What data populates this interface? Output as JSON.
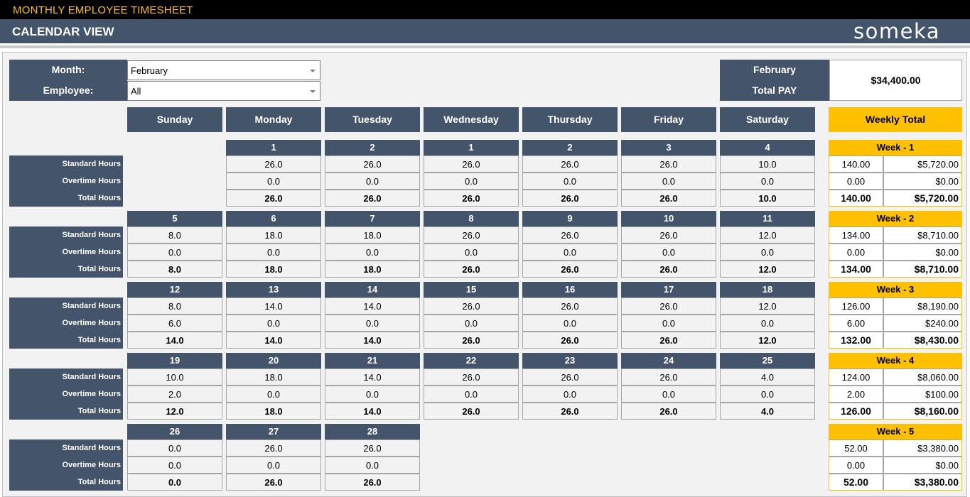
{
  "header": {
    "title": "MONTHLY EMPLOYEE TIMESHEET",
    "subtitle": "CALENDAR VIEW",
    "logo": "someka"
  },
  "filters": {
    "month_label": "Month:",
    "month_value": "February",
    "employee_label": "Employee:",
    "employee_value": "All"
  },
  "summary": {
    "month": "February",
    "label": "Total PAY",
    "value": "$34,400.00"
  },
  "days": [
    "Sunday",
    "Monday",
    "Tuesday",
    "Wednesday",
    "Thursday",
    "Friday",
    "Saturday"
  ],
  "weekly_total_label": "Weekly Total",
  "row_labels": [
    "Standard Hours",
    "Overtime Hours",
    "Total Hours"
  ],
  "weeks": [
    {
      "label": "Week - 1",
      "days": [
        null,
        {
          "date": "1",
          "std": "26.0",
          "ot": "0.0",
          "total": "26.0"
        },
        {
          "date": "2",
          "std": "26.0",
          "ot": "0.0",
          "total": "26.0"
        },
        {
          "date": "1",
          "std": "26.0",
          "ot": "0.0",
          "total": "26.0"
        },
        {
          "date": "2",
          "std": "26.0",
          "ot": "0.0",
          "total": "26.0"
        },
        {
          "date": "3",
          "std": "26.0",
          "ot": "0.0",
          "total": "26.0"
        },
        {
          "date": "4",
          "std": "10.0",
          "ot": "0.0",
          "total": "10.0"
        }
      ],
      "totals": {
        "std_hours": "140.00",
        "std_pay": "$5,720.00",
        "ot_hours": "0.00",
        "ot_pay": "$0.00",
        "total_hours": "140.00",
        "total_pay": "$5,720.00"
      }
    },
    {
      "label": "Week - 2",
      "days": [
        {
          "date": "5",
          "std": "8.0",
          "ot": "0.0",
          "total": "8.0"
        },
        {
          "date": "6",
          "std": "18.0",
          "ot": "0.0",
          "total": "18.0"
        },
        {
          "date": "7",
          "std": "18.0",
          "ot": "0.0",
          "total": "18.0"
        },
        {
          "date": "8",
          "std": "26.0",
          "ot": "0.0",
          "total": "26.0"
        },
        {
          "date": "9",
          "std": "26.0",
          "ot": "0.0",
          "total": "26.0"
        },
        {
          "date": "10",
          "std": "26.0",
          "ot": "0.0",
          "total": "26.0"
        },
        {
          "date": "11",
          "std": "12.0",
          "ot": "0.0",
          "total": "12.0"
        }
      ],
      "totals": {
        "std_hours": "134.00",
        "std_pay": "$8,710.00",
        "ot_hours": "0.00",
        "ot_pay": "$0.00",
        "total_hours": "134.00",
        "total_pay": "$8,710.00"
      }
    },
    {
      "label": "Week - 3",
      "days": [
        {
          "date": "12",
          "std": "8.0",
          "ot": "6.0",
          "total": "14.0"
        },
        {
          "date": "13",
          "std": "14.0",
          "ot": "0.0",
          "total": "14.0"
        },
        {
          "date": "14",
          "std": "14.0",
          "ot": "0.0",
          "total": "14.0"
        },
        {
          "date": "15",
          "std": "26.0",
          "ot": "0.0",
          "total": "26.0"
        },
        {
          "date": "16",
          "std": "26.0",
          "ot": "0.0",
          "total": "26.0"
        },
        {
          "date": "17",
          "std": "26.0",
          "ot": "0.0",
          "total": "26.0"
        },
        {
          "date": "18",
          "std": "12.0",
          "ot": "0.0",
          "total": "12.0"
        }
      ],
      "totals": {
        "std_hours": "126.00",
        "std_pay": "$8,190.00",
        "ot_hours": "6.00",
        "ot_pay": "$240.00",
        "total_hours": "132.00",
        "total_pay": "$8,430.00"
      }
    },
    {
      "label": "Week - 4",
      "days": [
        {
          "date": "19",
          "std": "10.0",
          "ot": "2.0",
          "total": "12.0"
        },
        {
          "date": "20",
          "std": "18.0",
          "ot": "0.0",
          "total": "18.0"
        },
        {
          "date": "21",
          "std": "14.0",
          "ot": "0.0",
          "total": "14.0"
        },
        {
          "date": "22",
          "std": "26.0",
          "ot": "0.0",
          "total": "26.0"
        },
        {
          "date": "23",
          "std": "26.0",
          "ot": "0.0",
          "total": "26.0"
        },
        {
          "date": "24",
          "std": "26.0",
          "ot": "0.0",
          "total": "26.0"
        },
        {
          "date": "25",
          "std": "4.0",
          "ot": "0.0",
          "total": "4.0"
        }
      ],
      "totals": {
        "std_hours": "124.00",
        "std_pay": "$8,060.00",
        "ot_hours": "2.00",
        "ot_pay": "$100.00",
        "total_hours": "126.00",
        "total_pay": "$8,160.00"
      }
    },
    {
      "label": "Week - 5",
      "days": [
        {
          "date": "26",
          "std": "0.0",
          "ot": "0.0",
          "total": "0.0"
        },
        {
          "date": "27",
          "std": "26.0",
          "ot": "0.0",
          "total": "26.0"
        },
        {
          "date": "28",
          "std": "26.0",
          "ot": "0.0",
          "total": "26.0"
        },
        null,
        null,
        null,
        null
      ],
      "totals": {
        "std_hours": "52.00",
        "std_pay": "$3,380.00",
        "ot_hours": "0.00",
        "ot_pay": "$0.00",
        "total_hours": "52.00",
        "total_pay": "$3,380.00"
      }
    }
  ],
  "colors": {
    "navy": "#44546a",
    "accent": "#ffc000"
  }
}
